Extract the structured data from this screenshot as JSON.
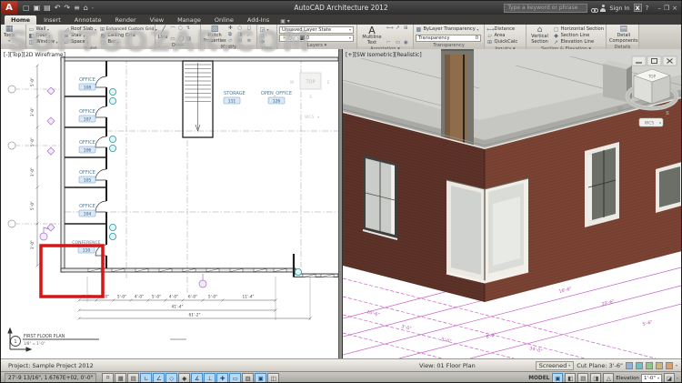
{
  "watermark": "SOFTGOZAR.COM",
  "titlebar": {
    "title": "AutoCAD Architecture 2012",
    "search_placeholder": "Type a keyword or phrase",
    "sign_in": "Sign In"
  },
  "tabs": [
    {
      "label": "Home"
    },
    {
      "label": "Insert"
    },
    {
      "label": "Annotate"
    },
    {
      "label": "Render"
    },
    {
      "label": "View"
    },
    {
      "label": "Manage"
    },
    {
      "label": "Online"
    },
    {
      "label": "Add-Ins"
    }
  ],
  "ribbon": {
    "tools": "Tools",
    "build": {
      "label": "Build",
      "col1": [
        "Wall",
        "Door",
        "Window"
      ],
      "col2": [
        "Roof Slab",
        "Stair",
        "Space"
      ],
      "col3": [
        "Enhanced Custom Grid",
        "Ceiling Grid",
        "Bar"
      ]
    },
    "draw": {
      "label": "Draw",
      "line": "Line"
    },
    "modify": {
      "label": "Modify",
      "match": "Match Properties"
    },
    "view": {
      "label": "View"
    },
    "layers": {
      "label": "Layers",
      "state": "Unsaved Layer State",
      "layer_value": "0"
    },
    "annotation": {
      "label": "Annotation",
      "multiline": "Multiline Text"
    },
    "transparency": {
      "label": "Transparency",
      "bylayer": "ByLayer Transparency",
      "field_label": "Transparency",
      "value": "0"
    },
    "inquiry": {
      "label": "Inquiry",
      "items": [
        "Distance",
        "Area",
        "QuickCalc"
      ]
    },
    "section": {
      "label": "Section & Elevation",
      "vertical": "Vertical Section",
      "items": [
        "Horizontal Section",
        "Section Line",
        "Elevation Line"
      ]
    },
    "details": {
      "label": "Details",
      "item": "Detail Components"
    }
  },
  "left_viewport": {
    "label": "[-][Top][2D Wireframe]",
    "viewcube": {
      "top": "TOP",
      "w": "W",
      "e": "E",
      "s": "S",
      "wcs": "WCS"
    },
    "rooms": [
      {
        "name": "OFFICE",
        "tag": "108"
      },
      {
        "name": "OFFICE",
        "tag": "107"
      },
      {
        "name": "OFFICE",
        "tag": "106"
      },
      {
        "name": "OFFICE",
        "tag": "105"
      },
      {
        "name": "OFFICE",
        "tag": "104"
      },
      {
        "name": "CONFERENCE",
        "tag": "110"
      },
      {
        "name": "STORAGE",
        "tag": "111"
      },
      {
        "name": "OPEN_OFFICE",
        "tag": "126"
      }
    ],
    "dims_bottom": [
      "5'-0\"",
      "4'-0\"",
      "5'-0\"",
      "4'-0\"",
      "5'-0\"",
      "4'-0\"",
      "6'-0\"",
      "5'-0\"",
      "11'-4\""
    ],
    "dims_total": [
      "41'-4\"",
      "61'-2\""
    ],
    "dims_left": [
      "5'-0\"",
      "3'-0\"",
      "5'-0\"",
      "3'-0\"",
      "5'-0\"",
      "3'-0\""
    ],
    "title_mark": {
      "number": "1",
      "title": "FIRST FLOOR PLAN",
      "scale": "1/8\" = 1'-0\""
    }
  },
  "right_viewport": {
    "label": "[+][SW Isometric][Realistic]",
    "viewcube": {
      "top": "TOP",
      "w": "W",
      "s": "S",
      "wcs": "WCS"
    },
    "dims": [
      "10'-6\"",
      "3'-0\"",
      "5'-0\"",
      "8'-0\"",
      "16'-6\"",
      "20'-6\"",
      "5'-6\"",
      "34'-0\""
    ]
  },
  "drawing_statusbar": {
    "project": "Project: Sample Project 2012",
    "view": "View: 01 Floor Plan",
    "display": "Screened",
    "cut_plane": "Cut Plane: 3'-6\""
  },
  "app_statusbar": {
    "coords": "27'-9 13/16\", 1.6767E+02, 0'-0\"",
    "model": "MODEL",
    "elevation_label": "Elevation",
    "elevation_value": "1'-0\""
  }
}
